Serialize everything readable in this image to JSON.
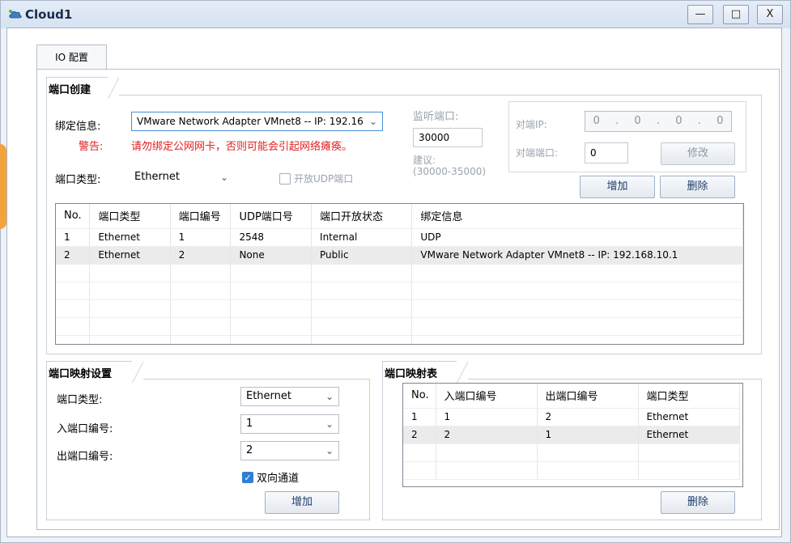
{
  "window": {
    "title": "Cloud1",
    "controls": {
      "minimize": "—",
      "maximize": "□",
      "close": "X"
    }
  },
  "tabs": [
    {
      "label": "IO 配置"
    }
  ],
  "port_create": {
    "group_title": "端口创建",
    "bind_label": "绑定信息:",
    "bind_value": "VMware Network Adapter VMnet8 -- IP: 192.16",
    "warning_label": "警告:",
    "warning_text": "请勿绑定公网网卡，否则可能会引起网络瘫痪。",
    "port_type_label": "端口类型:",
    "port_type_value": "Ethernet",
    "udp_checkbox_label": "开放UDP端口",
    "listen_port_label": "监听端口:",
    "listen_port_value": "30000",
    "suggest_label": "建议:",
    "suggest_range": "(30000-35000)",
    "peer_ip_label": "对端IP:",
    "peer_ip_octets": [
      "0",
      "0",
      "0",
      "0"
    ],
    "peer_port_label": "对端端口:",
    "peer_port_value": "0",
    "modify_button": "修改",
    "add_button": "增加",
    "delete_button": "删除",
    "table": {
      "columns": [
        "No.",
        "端口类型",
        "端口编号",
        "UDP端口号",
        "端口开放状态",
        "绑定信息"
      ],
      "rows": [
        [
          "1",
          "Ethernet",
          "1",
          "2548",
          "Internal",
          "UDP"
        ],
        [
          "2",
          "Ethernet",
          "2",
          "None",
          "Public",
          "VMware Network Adapter VMnet8 -- IP: 192.168.10.1"
        ]
      ]
    }
  },
  "mapping_settings": {
    "group_title": "端口映射设置",
    "port_type_label": "端口类型:",
    "port_type_value": "Ethernet",
    "in_port_label": "入端口编号:",
    "in_port_value": "1",
    "out_port_label": "出端口编号:",
    "out_port_value": "2",
    "bidirectional_label": "双向通道",
    "bidirectional_checked": true,
    "add_button": "增加"
  },
  "mapping_table": {
    "group_title": "端口映射表",
    "columns": [
      "No.",
      "入端口编号",
      "出端口编号",
      "端口类型"
    ],
    "rows": [
      [
        "1",
        "1",
        "2",
        "Ethernet"
      ],
      [
        "2",
        "2",
        "1",
        "Ethernet"
      ]
    ],
    "delete_button": "删除"
  }
}
